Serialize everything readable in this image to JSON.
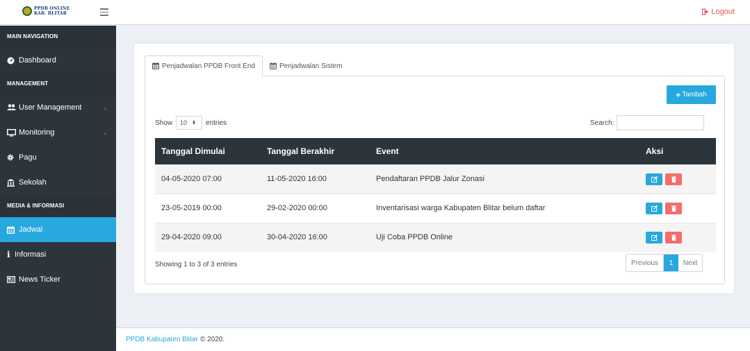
{
  "header": {
    "logo_line1": "PPDB ONLINE",
    "logo_line2": "KAB. BLITAR",
    "logout_label": "Logout"
  },
  "sidebar": {
    "sections": [
      {
        "header": "MAIN NAVIGATION"
      },
      {
        "header": "MANAGEMENT"
      },
      {
        "header": "MEDIA & INFORMASI"
      }
    ],
    "items": [
      {
        "label": "Dashboard",
        "icon": "dashboard-icon"
      },
      {
        "label": "User Management",
        "icon": "users-icon",
        "has_children": true
      },
      {
        "label": "Monitoring",
        "icon": "monitor-icon",
        "has_children": true
      },
      {
        "label": "Pagu",
        "icon": "cog-icon"
      },
      {
        "label": "Sekolah",
        "icon": "institution-icon"
      },
      {
        "label": "Jadwal",
        "icon": "calendar-icon",
        "active": true
      },
      {
        "label": "Informasi",
        "icon": "info-icon"
      },
      {
        "label": "News Ticker",
        "icon": "newspaper-icon"
      }
    ]
  },
  "tabs": [
    {
      "label": "Penjadwalan PPDB Front End",
      "active": true
    },
    {
      "label": "Penjadwalan Sistem",
      "active": false
    }
  ],
  "toolbar": {
    "add_label": "Tambah"
  },
  "datatable": {
    "show_label": "Show",
    "length_value": "10",
    "entries_label": "entries",
    "search_label": "Search:",
    "search_value": "",
    "columns": [
      "Tanggal Dimulai",
      "Tanggal Berakhir",
      "Event",
      "Aksi"
    ],
    "rows": [
      {
        "start": "04-05-2020 07:00",
        "end": "11-05-2020 16:00",
        "event": "Pendaftaran PPDB Jalur Zonasi"
      },
      {
        "start": "23-05-2019 00:00",
        "end": "29-02-2020 00:00",
        "event": "Inventarisasi warga Kabupaten Blitar belum daftar"
      },
      {
        "start": "29-04-2020 09:00",
        "end": "30-04-2020 16:00",
        "event": "Uji Coba PPDB Online"
      }
    ],
    "info": "Showing 1 to 3 of 3 entries",
    "pagination": {
      "previous": "Previous",
      "current": "1",
      "next": "Next"
    }
  },
  "footer": {
    "link_text": "PPDB Kabupaten Blitar",
    "copyright": "© 2020."
  },
  "colors": {
    "accent": "#27a8de",
    "sidebar_bg": "#2d353c",
    "danger": "#f36d6d",
    "logout": "#e8534a"
  }
}
